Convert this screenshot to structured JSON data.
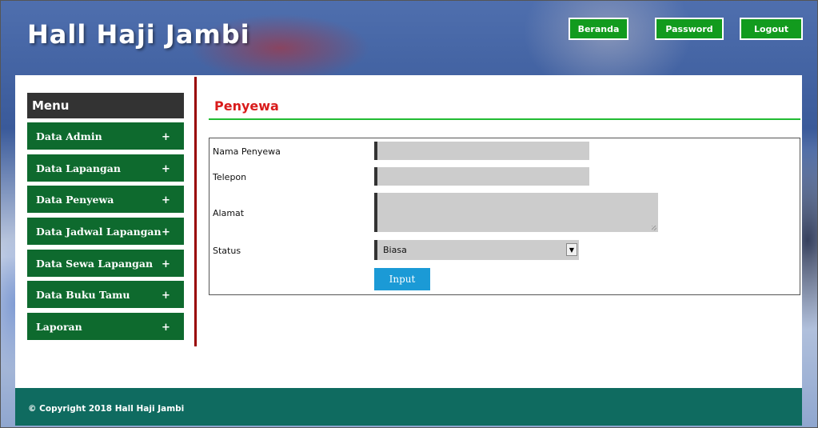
{
  "header": {
    "site_title": "Hall Haji Jambi",
    "nav": {
      "beranda": "Beranda",
      "password": "Password",
      "logout": "Logout"
    }
  },
  "sidebar": {
    "title": "Menu",
    "items": [
      {
        "label": "Data Admin",
        "icon": "+"
      },
      {
        "label": "Data Lapangan",
        "icon": "+"
      },
      {
        "label": "Data Penyewa",
        "icon": "+"
      },
      {
        "label": "Data Jadwal Lapangan",
        "icon": "+"
      },
      {
        "label": "Data Sewa Lapangan",
        "icon": "+"
      },
      {
        "label": "Data Buku Tamu",
        "icon": "+"
      },
      {
        "label": "Laporan",
        "icon": "+"
      }
    ]
  },
  "main": {
    "heading": "Penyewa",
    "form": {
      "fields": {
        "nama": {
          "label": "Nama Penyewa",
          "value": ""
        },
        "telepon": {
          "label": "Telepon",
          "value": ""
        },
        "alamat": {
          "label": "Alamat",
          "value": ""
        },
        "status": {
          "label": "Status",
          "selected": "Biasa"
        }
      },
      "submit_label": "Input"
    }
  },
  "footer": {
    "copyright": "© Copyright 2018 Hall Haji Jambi"
  },
  "colors": {
    "nav_button": "#129b1e",
    "menu_item": "#0e6a2e",
    "menu_title": "#333333",
    "heading": "#d91c1c",
    "heading_rule": "#22bb33",
    "divider": "#990000",
    "submit_button": "#1b9ad6",
    "footer": "#0f6b60"
  }
}
